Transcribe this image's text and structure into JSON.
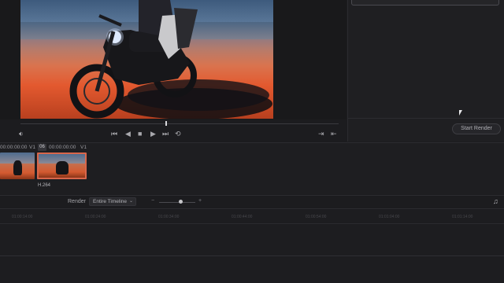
{
  "clips": [
    {
      "timecode": "00:00:00:00",
      "track": "V1"
    },
    {
      "number": "06",
      "timecode": "00:00:00:00",
      "track": "V1",
      "codec": "H.264"
    }
  ],
  "render_panel": {
    "start_render_label": "Start Render"
  },
  "render_bar": {
    "label": "Render",
    "selected": "Entire Timeline"
  },
  "ruler": {
    "timecodes": [
      "01:00:14:00",
      "01:00:24:00",
      "01:00:34:00",
      "01:00:44:00",
      "01:00:54:00",
      "01:01:04:00",
      "01:01:14:00"
    ]
  },
  "icons": {
    "volume": "volume-icon",
    "skip_start": "skip-to-start-icon",
    "step_back": "step-back-icon",
    "stop": "stop-icon",
    "play": "play-icon",
    "skip_end": "skip-to-end-icon",
    "loop": "loop-icon",
    "prev_clip": "prev-clip-icon",
    "next_clip": "next-clip-icon",
    "music": "music-note-icon"
  },
  "colors": {
    "accent_selected_clip": "#d8664b",
    "background": "#1c1c1f"
  }
}
